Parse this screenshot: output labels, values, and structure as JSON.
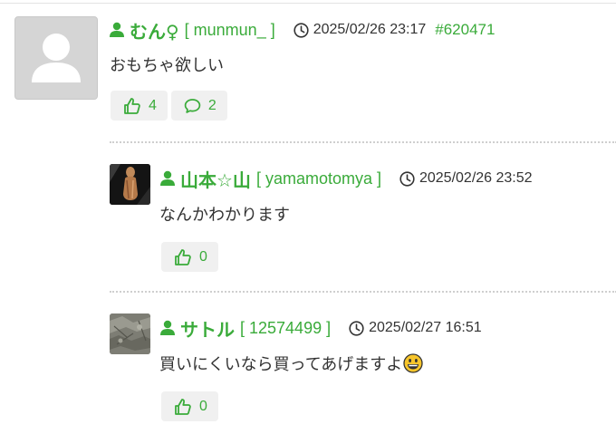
{
  "comments": [
    {
      "display_name": "むん♀",
      "user_id": "[ munmun_ ]",
      "timestamp": "2025/02/26 23:17",
      "comment_number": "#620471",
      "text": "おもちゃ欲しい",
      "like_count": "4",
      "reply_count": "2",
      "avatar": "default-avatar"
    },
    {
      "display_name": "山本☆山",
      "user_id": "[ yamamotomya ]",
      "timestamp": "2025/02/26 23:52",
      "text": "なんかわかります",
      "like_count": "0",
      "avatar": "figure-photo"
    },
    {
      "display_name": "サトル",
      "user_id": "[ 12574499 ]",
      "timestamp": "2025/02/27 16:51",
      "text": "買いにくいなら買ってあげますよ",
      "like_count": "0",
      "avatar": "rock-photo",
      "emoji": "grinning-face-emoji"
    }
  ],
  "colors": {
    "accent": "#3aab3a",
    "text": "#333333",
    "button_bg": "#f0f0f0",
    "divider": "#cfcfcf"
  },
  "icons": [
    "user-icon",
    "clock-icon",
    "thumbs-up-icon",
    "speech-bubble-icon"
  ]
}
